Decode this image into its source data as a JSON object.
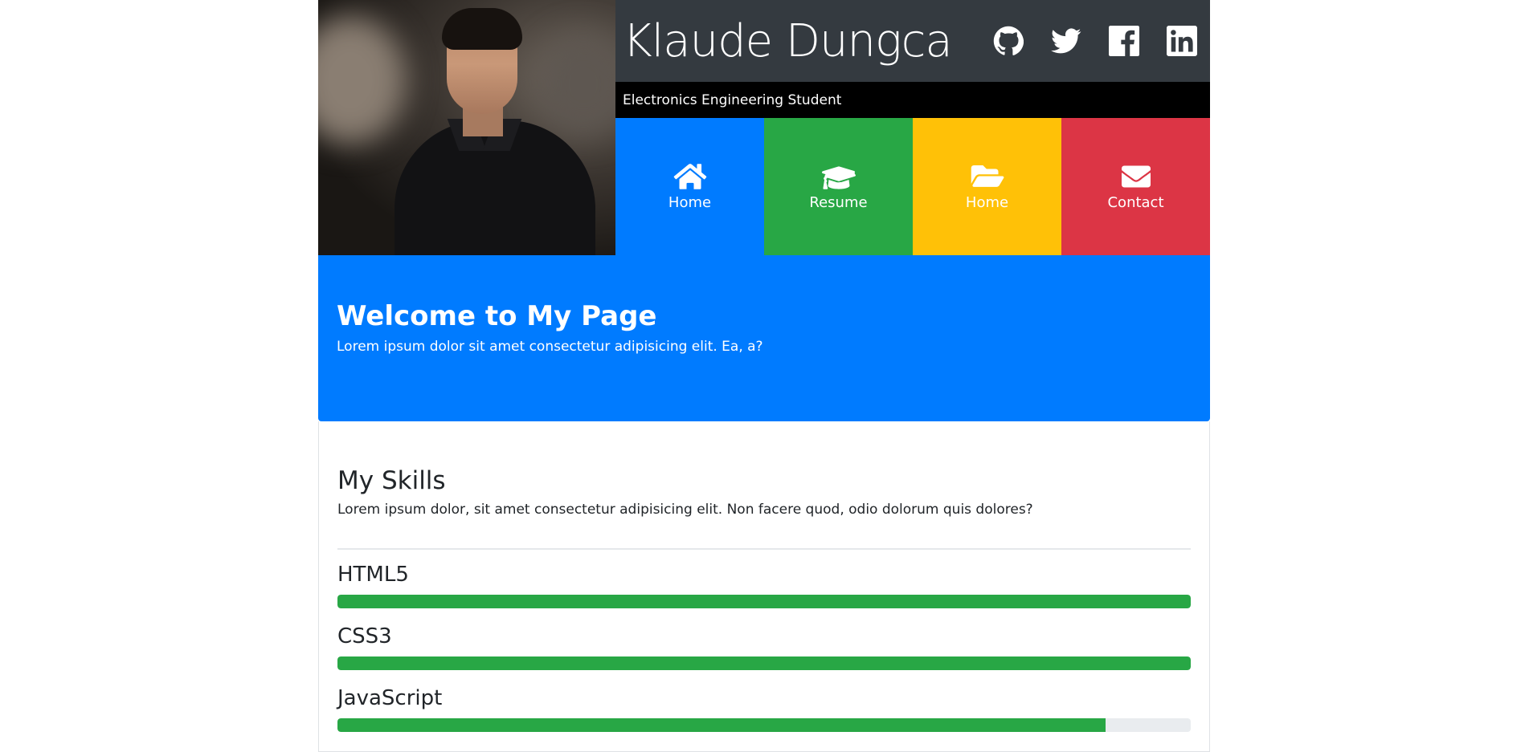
{
  "header": {
    "name": "Klaude Dungca",
    "subtitle": "Electronics Engineering Student",
    "socials": [
      {
        "icon": "github-icon"
      },
      {
        "icon": "twitter-icon"
      },
      {
        "icon": "facebook-icon"
      },
      {
        "icon": "linkedin-icon"
      }
    ]
  },
  "nav": {
    "tiles": [
      {
        "label": "Home",
        "icon": "home-icon",
        "color": "#007bff"
      },
      {
        "label": "Resume",
        "icon": "graduation-cap-icon",
        "color": "#28a745"
      },
      {
        "label": "Home",
        "icon": "folder-open-icon",
        "color": "#ffc107"
      },
      {
        "label": "Contact",
        "icon": "envelope-icon",
        "color": "#dc3545"
      }
    ]
  },
  "welcome": {
    "title": "Welcome to My Page",
    "text": "Lorem ipsum dolor sit amet consectetur adipisicing elit. Ea, a?"
  },
  "skills": {
    "title": "My Skills",
    "text": "Lorem ipsum dolor, sit amet consectetur adipisicing elit. Non facere quod, odio dolorum quis dolores?",
    "items": [
      {
        "name": "HTML5",
        "level": 1.0
      },
      {
        "name": "CSS3",
        "level": 1.0
      },
      {
        "name": "JavaScript",
        "level": 0.9
      }
    ]
  },
  "colors": {
    "titlebar": "#343a40",
    "jumbotron": "#007bff",
    "progress": "#28a745"
  }
}
